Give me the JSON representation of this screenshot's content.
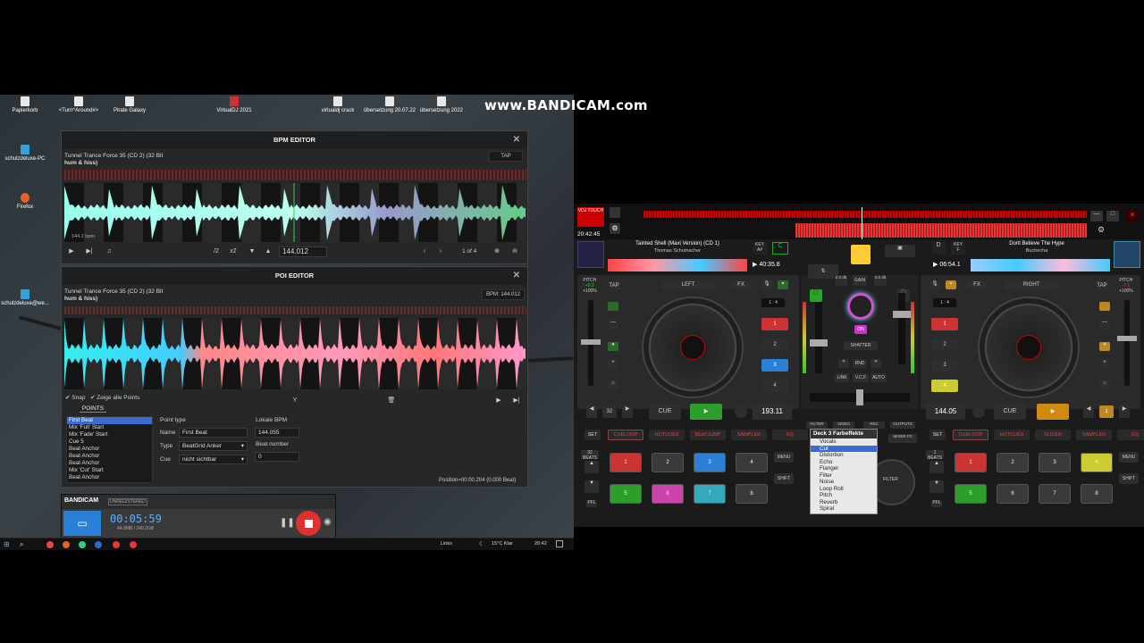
{
  "watermark": "www.BANDICAM.com",
  "desktop": {
    "icons": [
      "Papierkorb",
      "<Turn^Around#>",
      "Pirate Galaxy",
      "VirtualDJ 2021",
      "virtualdj crack",
      "übersetzung 20.07.22",
      "übersetzung 2022",
      "schulzdeluxe-PC",
      "Firefox",
      "schulzdeluxe@we..."
    ]
  },
  "bpm_editor": {
    "title": "BPM EDITOR",
    "track": "Tunnel Trance Force 35 (CD 2) (32 Bit",
    "artist": "hum & hiss)",
    "tap": "TAP",
    "bpm_overlay": "144.1 bpm",
    "half": "/2",
    "double": "x2",
    "bpm_value": "144.012",
    "page": "1 of 4"
  },
  "poi_editor": {
    "title": "POI EDITOR",
    "track": "Tunnel Trance Force 35 (CD 2) (32 Bit",
    "artist": "hum & hiss)",
    "bpm": "BPM: 144.012",
    "snap": "Snap",
    "show_all": "Zeige alle Points",
    "points_header": "POINTS",
    "points": [
      "First Beat",
      "Mix 'Full' Start",
      "Mix 'Fade' Start",
      "Cue 5",
      "Beat Anchor",
      "Beat Anchor",
      "Beat Anchor",
      "Mix 'Cut' Start",
      "Beat Anchor"
    ],
    "point_type_label": "Point type",
    "name_label": "Name",
    "name_value": "First Beat",
    "type_label": "Type",
    "type_value": "BeatGrid Anker",
    "cue_label": "Cue",
    "cue_value": "nicht sichtbar",
    "local_bpm_label": "Lokale BPM",
    "local_bpm_value": "144.055",
    "beat_number_label": "Beat number",
    "beat_number_value": "0",
    "position": "Position=00:00.204 (0.000 Beat)"
  },
  "bandicam": {
    "logo": "BANDICAM",
    "unreg": "UNREGISTERED",
    "time": "00:05:59",
    "size": "44.9MB / 240.2GB"
  },
  "taskbar": {
    "links": "Links",
    "weather": "15°C  Klar",
    "clock": "20:42"
  },
  "vdj": {
    "clock": "20:42:45",
    "left": {
      "title": "Tainted Shell (Maxi Version) (CD 1)",
      "artist": "Thomas Schumacher",
      "key": "A#",
      "time": "40:35.8",
      "pitch": "+0.2",
      "pct": "+100%",
      "side": "LEFT",
      "fx": "FX",
      "tap": "TAP",
      "cue": "CUE",
      "bpm": "193.11",
      "loop": "32",
      "beats": "32 BEATS",
      "modes": [
        "SET",
        "CUELOOP",
        "HOTCUES",
        "BEATJUMP",
        "SAMPLER",
        "EQ"
      ],
      "pads": [
        "1",
        "2",
        "3",
        "4",
        "5",
        "6",
        "7",
        "8"
      ],
      "hot": [
        "1",
        "2",
        "3",
        "4"
      ]
    },
    "right": {
      "title": "Dont Believe The Hype",
      "artist": "Buchecha",
      "key": "F",
      "time": "06:54.1",
      "pitch": "-7.1",
      "pct": "+100%",
      "side": "RIGHT",
      "fx": "FX",
      "tap": "TAP",
      "cue": "CUE",
      "bpm": "144.05",
      "loop": "1",
      "beats": "1 BEATS",
      "modes": [
        "SET",
        "CUELOOP",
        "HOTCUES",
        "SLICER",
        "SAMPLER",
        "EQ"
      ],
      "pads": [
        "1",
        "2",
        "3",
        "4",
        "5",
        "6",
        "7",
        "8"
      ],
      "hot": [
        "1",
        "2",
        "3",
        "4"
      ]
    },
    "mixer": {
      "gain": "GAIN",
      "db": "0.0 db",
      "on": "ON",
      "shatter": "SHATTER",
      "rnd": "RND",
      "link": "LINK",
      "vcf": "V.C.F",
      "auto": "AUTO",
      "filter": "FILTER",
      "video": "VIDEO",
      "rec": "REC",
      "outputs": "OUTPUTS",
      "mixerfx": "MIXER FX",
      "ratio": "1 : 4"
    },
    "fx_menu": {
      "title": "Deck 3 Farbeffekte",
      "items": [
        "Vocals",
        "Cut",
        "Distortion",
        "Echo",
        "Flanger",
        "Filter",
        "Noise",
        "Loop Roll",
        "Pitch",
        "Reverb",
        "Spiral"
      ],
      "selected": 1
    },
    "menu": "MENU",
    "shift": "SHIFT",
    "pfl": "PFL"
  }
}
